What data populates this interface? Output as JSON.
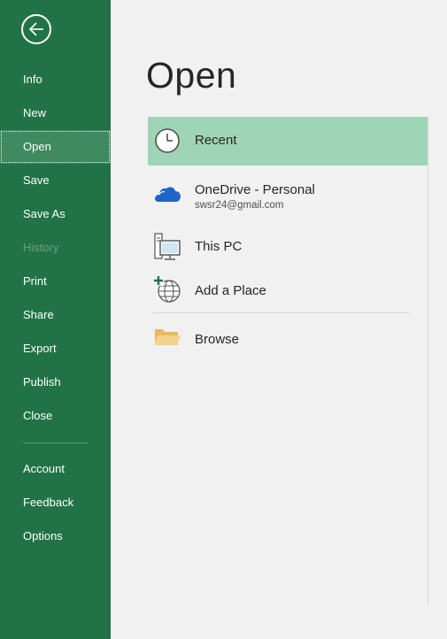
{
  "sidebar": {
    "items": [
      {
        "label": "Info"
      },
      {
        "label": "New"
      },
      {
        "label": "Open"
      },
      {
        "label": "Save"
      },
      {
        "label": "Save As"
      },
      {
        "label": "History"
      },
      {
        "label": "Print"
      },
      {
        "label": "Share"
      },
      {
        "label": "Export"
      },
      {
        "label": "Publish"
      },
      {
        "label": "Close"
      },
      {
        "label": "Account"
      },
      {
        "label": "Feedback"
      },
      {
        "label": "Options"
      }
    ],
    "active_item": "Open",
    "disabled_items": [
      "History"
    ],
    "back_icon": "back-arrow-icon"
  },
  "main": {
    "title": "Open",
    "locations": [
      {
        "label": "Recent",
        "icon": "clock-icon"
      },
      {
        "label": "OneDrive - Personal",
        "sublabel": "swsr24@gmail.com",
        "icon": "onedrive-cloud-icon"
      },
      {
        "label": "This PC",
        "icon": "computer-icon"
      },
      {
        "label": "Add a Place",
        "icon": "add-place-globe-icon"
      },
      {
        "label": "Browse",
        "icon": "folder-icon"
      }
    ],
    "selected_location": "Recent"
  },
  "colors": {
    "sidebar_bg": "#217346",
    "sidebar_active": "#3f8a5f",
    "selected_location_bg": "#9fd5b7",
    "main_bg": "#f1f1f1"
  }
}
